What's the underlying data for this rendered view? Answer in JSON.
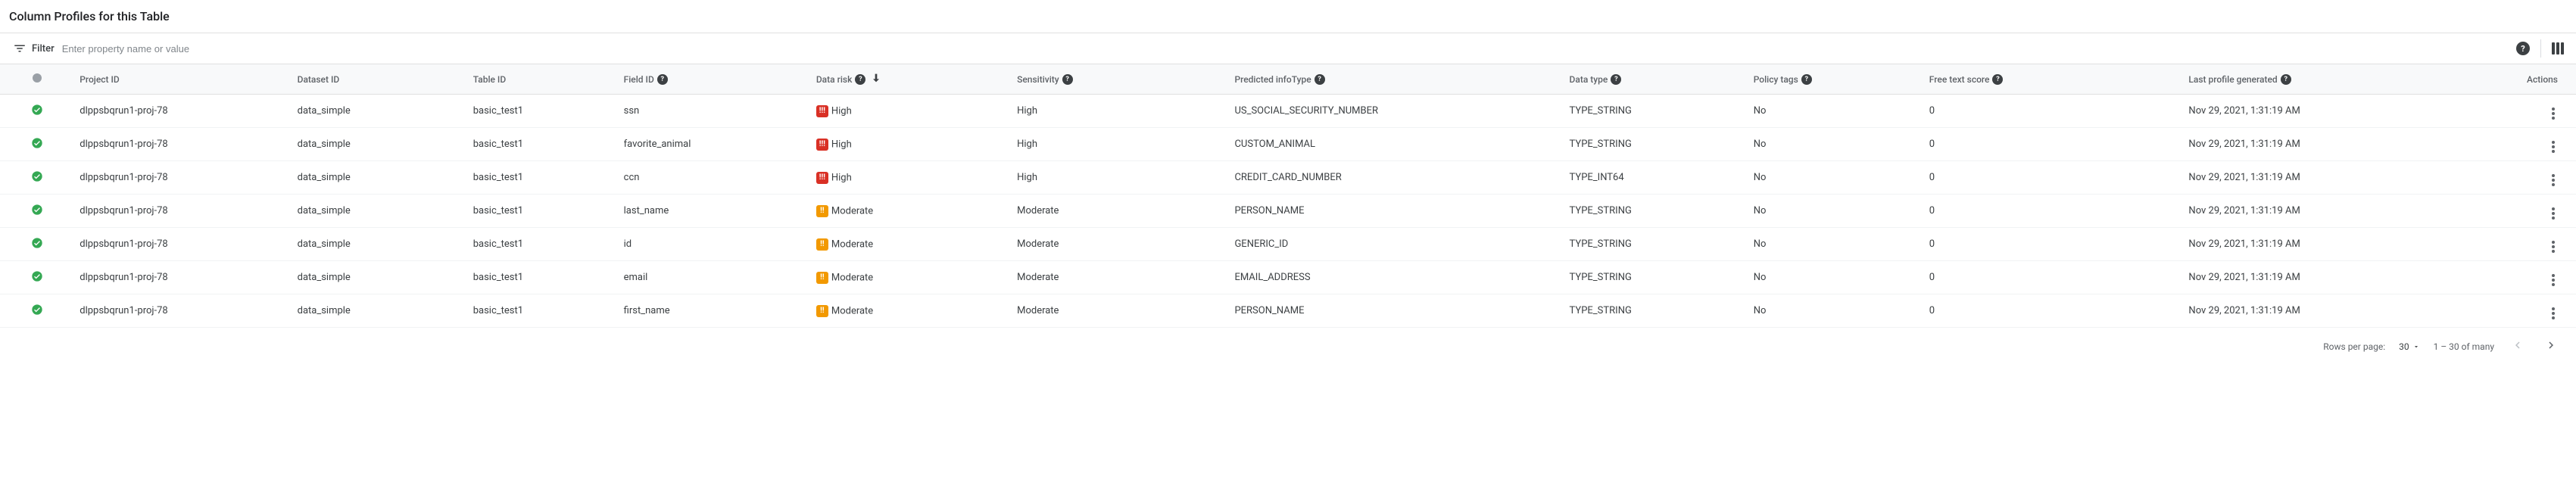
{
  "title": "Column Profiles for this Table",
  "filter": {
    "label": "Filter",
    "placeholder": "Enter property name or value"
  },
  "columns": {
    "project_id": "Project ID",
    "dataset_id": "Dataset ID",
    "table_id": "Table ID",
    "field_id": "Field ID",
    "data_risk": "Data risk",
    "sensitivity": "Sensitivity",
    "predicted_infotype": "Predicted infoType",
    "data_type": "Data type",
    "policy_tags": "Policy tags",
    "free_text_score": "Free text score",
    "last_profile_generated": "Last profile generated",
    "actions": "Actions"
  },
  "rows": [
    {
      "project_id": "dlppsbqrun1-proj-78",
      "dataset_id": "data_simple",
      "table_id": "basic_test1",
      "field_id": "ssn",
      "data_risk": "High",
      "data_risk_level": "high",
      "sensitivity": "High",
      "predicted_infotype": "US_SOCIAL_SECURITY_NUMBER",
      "data_type": "TYPE_STRING",
      "policy_tags": "No",
      "free_text_score": "0",
      "last_profile_generated": "Nov 29, 2021, 1:31:19 AM"
    },
    {
      "project_id": "dlppsbqrun1-proj-78",
      "dataset_id": "data_simple",
      "table_id": "basic_test1",
      "field_id": "favorite_animal",
      "data_risk": "High",
      "data_risk_level": "high",
      "sensitivity": "High",
      "predicted_infotype": "CUSTOM_ANIMAL",
      "data_type": "TYPE_STRING",
      "policy_tags": "No",
      "free_text_score": "0",
      "last_profile_generated": "Nov 29, 2021, 1:31:19 AM"
    },
    {
      "project_id": "dlppsbqrun1-proj-78",
      "dataset_id": "data_simple",
      "table_id": "basic_test1",
      "field_id": "ccn",
      "data_risk": "High",
      "data_risk_level": "high",
      "sensitivity": "High",
      "predicted_infotype": "CREDIT_CARD_NUMBER",
      "data_type": "TYPE_INT64",
      "policy_tags": "No",
      "free_text_score": "0",
      "last_profile_generated": "Nov 29, 2021, 1:31:19 AM"
    },
    {
      "project_id": "dlppsbqrun1-proj-78",
      "dataset_id": "data_simple",
      "table_id": "basic_test1",
      "field_id": "last_name",
      "data_risk": "Moderate",
      "data_risk_level": "moderate",
      "sensitivity": "Moderate",
      "predicted_infotype": "PERSON_NAME",
      "data_type": "TYPE_STRING",
      "policy_tags": "No",
      "free_text_score": "0",
      "last_profile_generated": "Nov 29, 2021, 1:31:19 AM"
    },
    {
      "project_id": "dlppsbqrun1-proj-78",
      "dataset_id": "data_simple",
      "table_id": "basic_test1",
      "field_id": "id",
      "data_risk": "Moderate",
      "data_risk_level": "moderate",
      "sensitivity": "Moderate",
      "predicted_infotype": "GENERIC_ID",
      "data_type": "TYPE_STRING",
      "policy_tags": "No",
      "free_text_score": "0",
      "last_profile_generated": "Nov 29, 2021, 1:31:19 AM"
    },
    {
      "project_id": "dlppsbqrun1-proj-78",
      "dataset_id": "data_simple",
      "table_id": "basic_test1",
      "field_id": "email",
      "data_risk": "Moderate",
      "data_risk_level": "moderate",
      "sensitivity": "Moderate",
      "predicted_infotype": "EMAIL_ADDRESS",
      "data_type": "TYPE_STRING",
      "policy_tags": "No",
      "free_text_score": "0",
      "last_profile_generated": "Nov 29, 2021, 1:31:19 AM"
    },
    {
      "project_id": "dlppsbqrun1-proj-78",
      "dataset_id": "data_simple",
      "table_id": "basic_test1",
      "field_id": "first_name",
      "data_risk": "Moderate",
      "data_risk_level": "moderate",
      "sensitivity": "Moderate",
      "predicted_infotype": "PERSON_NAME",
      "data_type": "TYPE_STRING",
      "policy_tags": "No",
      "free_text_score": "0",
      "last_profile_generated": "Nov 29, 2021, 1:31:19 AM"
    }
  ],
  "pagination": {
    "rows_per_page_label": "Rows per page:",
    "rows_per_page_value": "30",
    "range_label": "1 – 30 of many"
  },
  "icons": {
    "risk_high": "!!!",
    "risk_moderate": "!!"
  }
}
